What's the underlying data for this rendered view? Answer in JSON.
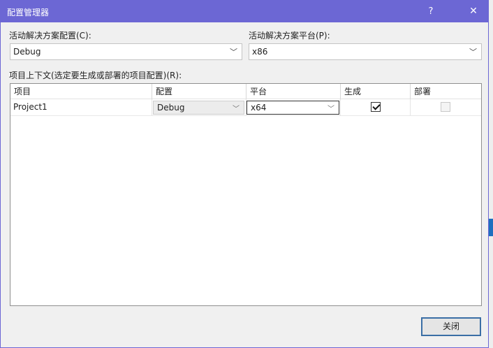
{
  "window": {
    "title": "配置管理器",
    "help_glyph": "?",
    "close_glyph": "✕"
  },
  "solution_config": {
    "label": "活动解决方案配置(C):",
    "value": "Debug"
  },
  "solution_platform": {
    "label": "活动解决方案平台(P):",
    "value": "x86"
  },
  "project_context": {
    "label": "项目上下文(选定要生成或部署的项目配置)(R):",
    "columns": [
      "项目",
      "配置",
      "平台",
      "生成",
      "部署"
    ],
    "rows": [
      {
        "project": "Project1",
        "configuration": "Debug",
        "platform": "x64",
        "build": true,
        "deploy": false
      }
    ]
  },
  "buttons": {
    "close_label": "关闭"
  },
  "icons": {
    "dropdown": "chevron-down-icon"
  }
}
